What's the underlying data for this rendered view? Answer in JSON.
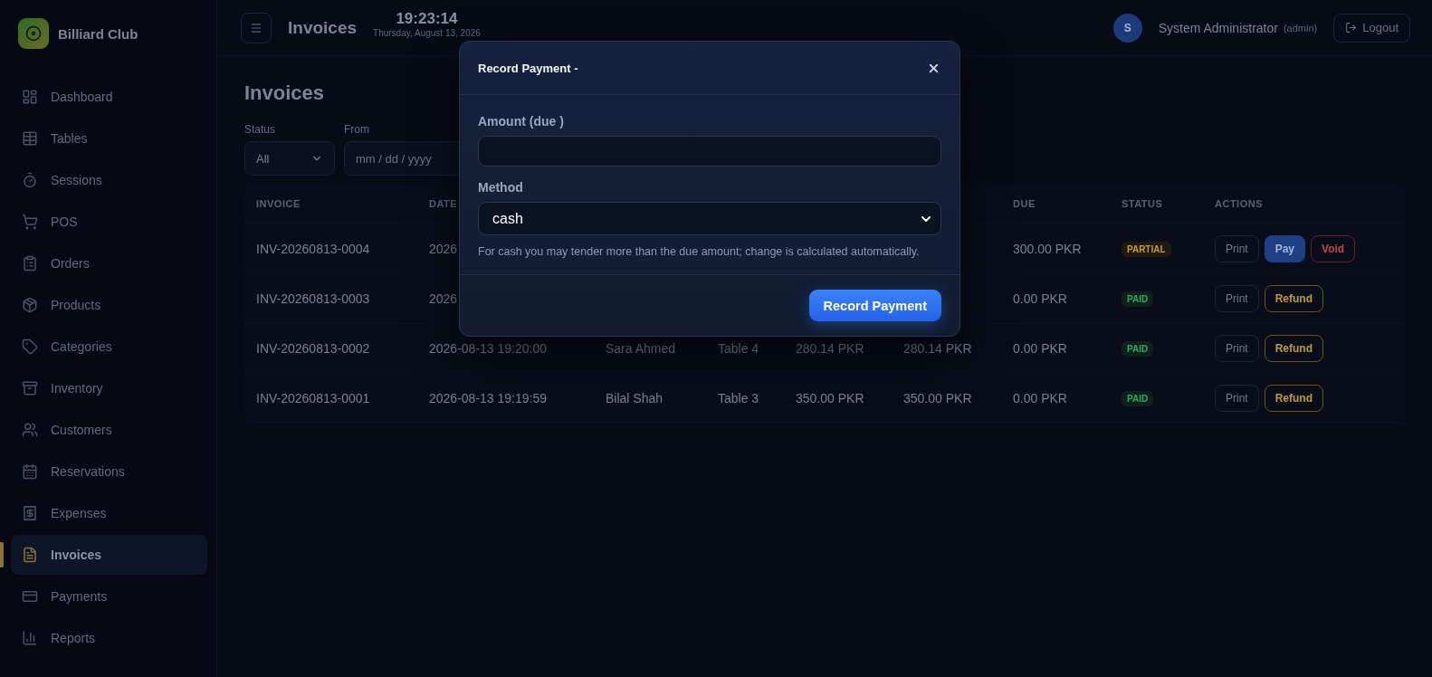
{
  "brand": {
    "name": "Billiard Club"
  },
  "nav": [
    {
      "label": "Dashboard",
      "selected": false
    },
    {
      "label": "Tables",
      "selected": false
    },
    {
      "label": "Sessions",
      "selected": false
    },
    {
      "label": "POS",
      "selected": false
    },
    {
      "label": "Orders",
      "selected": false
    },
    {
      "label": "Products",
      "selected": false
    },
    {
      "label": "Categories",
      "selected": false
    },
    {
      "label": "Inventory",
      "selected": false
    },
    {
      "label": "Customers",
      "selected": false
    },
    {
      "label": "Reservations",
      "selected": false
    },
    {
      "label": "Expenses",
      "selected": false
    },
    {
      "label": "Invoices",
      "selected": true
    },
    {
      "label": "Payments",
      "selected": false
    },
    {
      "label": "Reports",
      "selected": false
    }
  ],
  "header": {
    "title": "Invoices",
    "clock": "19:23:14",
    "date": "Thursday, August 13, 2026",
    "avatar": "S",
    "user": "System Administrator",
    "role": "(admin)",
    "logout": "Logout"
  },
  "page": {
    "title": "Invoices",
    "filters": [
      {
        "label": "Status",
        "kind": "select",
        "value": "All"
      },
      {
        "label": "From",
        "kind": "date",
        "placeholder": "mm / dd / yyyy"
      }
    ]
  },
  "table": {
    "columns": [
      "INVOICE",
      "DATE",
      "",
      "",
      "",
      "",
      "DUE",
      "STATUS",
      "ACTIONS"
    ],
    "rows": [
      {
        "cells": [
          "INV-20260813-0004",
          "2026",
          "",
          "",
          "",
          "",
          "300.00 PKR"
        ],
        "status": {
          "label": "PARTIAL",
          "kind": "partial"
        },
        "actions": [
          {
            "label": "Print",
            "kind": "neutral"
          },
          {
            "label": "Pay",
            "kind": "primary"
          },
          {
            "label": "Void",
            "kind": "danger"
          }
        ]
      },
      {
        "cells": [
          "INV-20260813-0003",
          "2026",
          "",
          "",
          "",
          "",
          "0.00 PKR"
        ],
        "status": {
          "label": "PAID",
          "kind": "paid"
        },
        "actions": [
          {
            "label": "Print",
            "kind": "neutral"
          },
          {
            "label": "Refund",
            "kind": "warning"
          }
        ]
      },
      {
        "cells": [
          "INV-20260813-0002",
          "2026-08-13 19:20:00",
          "Sara Ahmed",
          "Table 4",
          "280.14 PKR",
          "280.14 PKR",
          "0.00 PKR"
        ],
        "status": {
          "label": "PAID",
          "kind": "paid"
        },
        "actions": [
          {
            "label": "Print",
            "kind": "neutral"
          },
          {
            "label": "Refund",
            "kind": "warning"
          }
        ]
      },
      {
        "cells": [
          "INV-20260813-0001",
          "2026-08-13 19:19:59",
          "Bilal Shah",
          "Table 3",
          "350.00 PKR",
          "350.00 PKR",
          "0.00 PKR"
        ],
        "status": {
          "label": "PAID",
          "kind": "paid"
        },
        "actions": [
          {
            "label": "Print",
            "kind": "neutral"
          },
          {
            "label": "Refund",
            "kind": "warning"
          }
        ]
      }
    ]
  },
  "modal": {
    "title": "Record Payment -",
    "fields": [
      {
        "label": "Amount (due )",
        "kind": "input"
      },
      {
        "label": "Method",
        "kind": "select",
        "value": "cash"
      }
    ],
    "help": "For cash you may tender more than the due amount; change is calculated automatically.",
    "submit": "Record Payment"
  }
}
